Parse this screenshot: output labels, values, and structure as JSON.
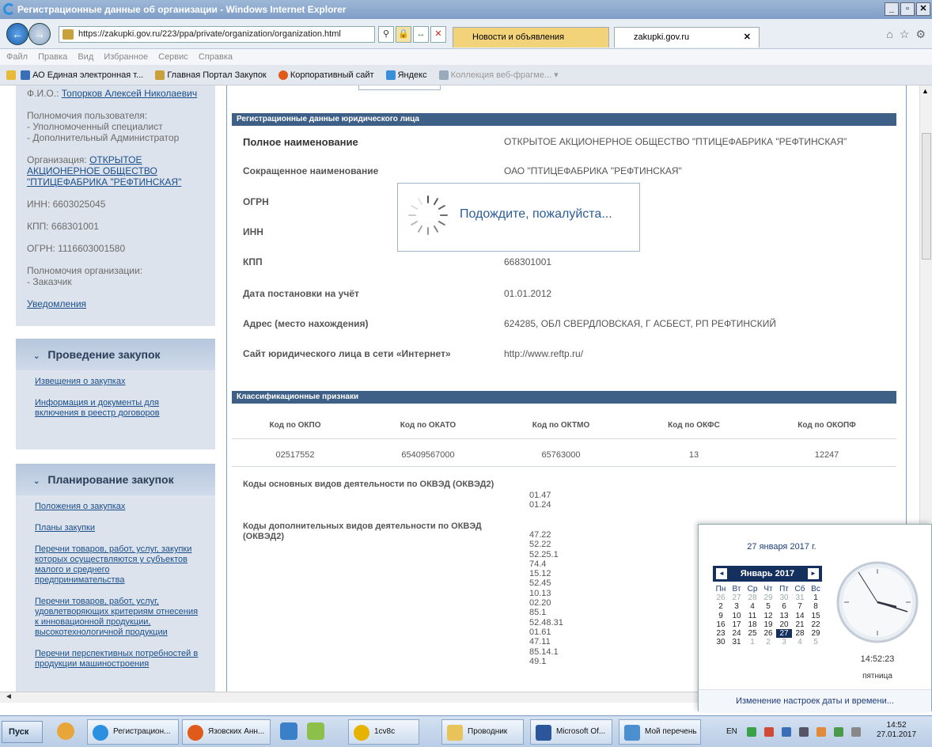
{
  "window": {
    "title": "Регистрационные данные об организации - Windows Internet Explorer"
  },
  "browser": {
    "url": "https://zakupki.gov.ru/223/ppa/private/organization/organization.html",
    "tabs": [
      {
        "label": "Новости и объявления"
      },
      {
        "label": "zakupki.gov.ru"
      }
    ],
    "menu": [
      "Файл",
      "Правка",
      "Вид",
      "Избранное",
      "Сервис",
      "Справка"
    ],
    "favorites": [
      "АО Единая электронная т...",
      "Главная Портал Закупок",
      "Корпоративный сайт",
      "Яндекс",
      "Коллекция веб-фрагме..."
    ]
  },
  "sidebar": {
    "fio_label": "Ф.И.О.:",
    "fio_value": "Топорков Алексей Николаевич",
    "powers_label": "Полномочия пользователя:",
    "powers": [
      "- Уполномоченный специалист",
      "- Дополнительный Администратор"
    ],
    "org_label": "Организация:",
    "org_value": "ОТКРЫТОЕ АКЦИОНЕРНОЕ ОБЩЕСТВО \"ПТИЦЕФАБРИКА \"РЕФТИНСКАЯ\"",
    "inn": "ИНН: 6603025045",
    "kpp": "КПП: 668301001",
    "ogrn": "ОГРН: 1116603001580",
    "org_powers_label": "Полномочия организации:",
    "org_powers": "- Заказчик",
    "notifications": "Уведомления",
    "sections": [
      {
        "title": "Проведение закупок",
        "links": [
          "Извещения о закупках",
          "Информация и документы для включения в реестр договоров"
        ]
      },
      {
        "title": "Планирование закупок",
        "links": [
          "Положения о закупках",
          "Планы закупки",
          "Перечни товаров, работ, услуг, закупки которых осуществляются у субъектов малого и среднего предпринимательства",
          "Перечни товаров, работ, услуг, удовлетворяющих критериям отнесения к инновационной продукции, высокотехнологичной продукции",
          "Перечни перспективных потребностей в продукции машиностроения"
        ]
      }
    ]
  },
  "main": {
    "reg_header": "Регистрационные данные юридического лица",
    "fields": [
      {
        "label": "Полное наименование",
        "value": "ОТКРЫТОЕ АКЦИОНЕРНОЕ ОБЩЕСТВО \"ПТИЦЕФАБРИКА \"РЕФТИНСКАЯ\""
      },
      {
        "label": "Сокращенное наименование",
        "value": "ОАО \"ПТИЦЕФАБРИКА \"РЕФТИНСКАЯ\""
      },
      {
        "label": "ОГРН",
        "value": ""
      },
      {
        "label": "ИНН",
        "value": ""
      },
      {
        "label": "КПП",
        "value": "668301001"
      },
      {
        "label": "Дата постановки на учёт",
        "value": "01.01.2012"
      },
      {
        "label": "Адрес (место нахождения)",
        "value": "624285, ОБЛ СВЕРДЛОВСКАЯ, Г АСБЕСТ, РП РЕФТИНСКИЙ"
      },
      {
        "label": "Сайт юридического лица в сети «Интернет»",
        "value": "http://www.reftp.ru/"
      }
    ],
    "class_header": "Классификационные признаки",
    "class_cols": [
      "Код по ОКПО",
      "Код по ОКАТО",
      "Код по ОКТМО",
      "Код по ОКФС",
      "Код по ОКОПФ"
    ],
    "class_vals": [
      "02517552",
      "65409567000",
      "65763000",
      "13",
      "12247"
    ],
    "okved_main_label": "Коды основных видов деятельности по ОКВЭД (ОКВЭД2)",
    "okved_main": [
      "01.47",
      "01.24"
    ],
    "okved_extra_label": "Коды дополнительных видов деятельности по ОКВЭД (ОКВЭД2)",
    "okved_extra": [
      "47.22",
      "52.22",
      "52.25.1",
      "74.4",
      "15.12",
      "52.45",
      "10.13",
      "02.20",
      "85.1",
      "52.48.31",
      "01.61",
      "47.11",
      "85.14.1",
      "49.1"
    ]
  },
  "loader": {
    "text": "Подождите, пожалуйста..."
  },
  "calendar": {
    "date_long": "27 января 2017 г.",
    "month": "Январь 2017",
    "weekdays": [
      "Пн",
      "Вт",
      "Ср",
      "Чт",
      "Пт",
      "Сб",
      "Вс"
    ],
    "weeks": [
      [
        "26",
        "27",
        "28",
        "29",
        "30",
        "31",
        "1"
      ],
      [
        "2",
        "3",
        "4",
        "5",
        "6",
        "7",
        "8"
      ],
      [
        "9",
        "10",
        "11",
        "12",
        "13",
        "14",
        "15"
      ],
      [
        "16",
        "17",
        "18",
        "19",
        "20",
        "21",
        "22"
      ],
      [
        "23",
        "24",
        "25",
        "26",
        "27",
        "28",
        "29"
      ],
      [
        "30",
        "31",
        "1",
        "2",
        "3",
        "4",
        "5"
      ]
    ],
    "selected": "27",
    "time": "14:52:23",
    "weekday": "пятница",
    "footer": "Изменение настроек даты и времени..."
  },
  "taskbar": {
    "start": "Пуск",
    "items": [
      "Регистрацион...",
      "Язовских Анн...",
      "1cv8c",
      "Проводник",
      "Microsoft Of...",
      "Мой перечень"
    ],
    "lang": "EN",
    "time": "14:52",
    "date": "27.01.2017"
  }
}
